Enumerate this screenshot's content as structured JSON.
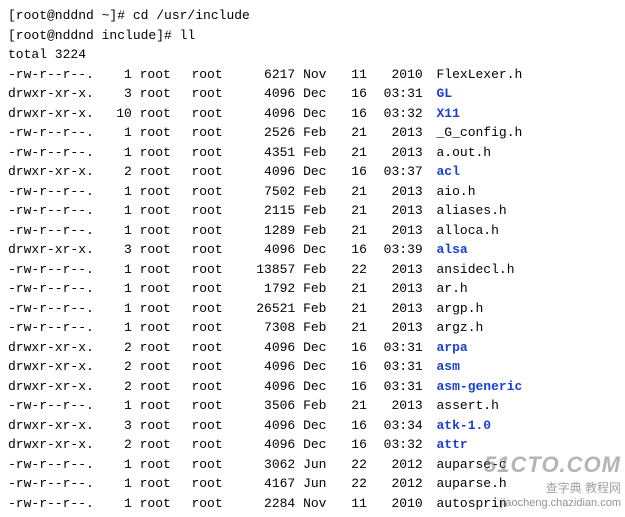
{
  "prompts": [
    {
      "prefix": "[root@nddnd ~]# ",
      "command": "cd /usr/include"
    },
    {
      "prefix": "[root@nddnd include]# ",
      "command": "ll"
    }
  ],
  "total_line": "total 3224",
  "entries": [
    {
      "perm": "-rw-r--r--.",
      "links": "1",
      "owner": "root",
      "group": "root",
      "size": "6217",
      "month": "Nov",
      "day": "11",
      "time": "2010",
      "name": "FlexLexer.h",
      "type": "file"
    },
    {
      "perm": "drwxr-xr-x.",
      "links": "3",
      "owner": "root",
      "group": "root",
      "size": "4096",
      "month": "Dec",
      "day": "16",
      "time": "03:31",
      "name": "GL",
      "type": "dir"
    },
    {
      "perm": "drwxr-xr-x.",
      "links": "10",
      "owner": "root",
      "group": "root",
      "size": "4096",
      "month": "Dec",
      "day": "16",
      "time": "03:32",
      "name": "X11",
      "type": "dir"
    },
    {
      "perm": "-rw-r--r--.",
      "links": "1",
      "owner": "root",
      "group": "root",
      "size": "2526",
      "month": "Feb",
      "day": "21",
      "time": "2013",
      "name": "_G_config.h",
      "type": "file"
    },
    {
      "perm": "-rw-r--r--.",
      "links": "1",
      "owner": "root",
      "group": "root",
      "size": "4351",
      "month": "Feb",
      "day": "21",
      "time": "2013",
      "name": "a.out.h",
      "type": "file"
    },
    {
      "perm": "drwxr-xr-x.",
      "links": "2",
      "owner": "root",
      "group": "root",
      "size": "4096",
      "month": "Dec",
      "day": "16",
      "time": "03:37",
      "name": "acl",
      "type": "dir"
    },
    {
      "perm": "-rw-r--r--.",
      "links": "1",
      "owner": "root",
      "group": "root",
      "size": "7502",
      "month": "Feb",
      "day": "21",
      "time": "2013",
      "name": "aio.h",
      "type": "file"
    },
    {
      "perm": "-rw-r--r--.",
      "links": "1",
      "owner": "root",
      "group": "root",
      "size": "2115",
      "month": "Feb",
      "day": "21",
      "time": "2013",
      "name": "aliases.h",
      "type": "file"
    },
    {
      "perm": "-rw-r--r--.",
      "links": "1",
      "owner": "root",
      "group": "root",
      "size": "1289",
      "month": "Feb",
      "day": "21",
      "time": "2013",
      "name": "alloca.h",
      "type": "file"
    },
    {
      "perm": "drwxr-xr-x.",
      "links": "3",
      "owner": "root",
      "group": "root",
      "size": "4096",
      "month": "Dec",
      "day": "16",
      "time": "03:39",
      "name": "alsa",
      "type": "dir"
    },
    {
      "perm": "-rw-r--r--.",
      "links": "1",
      "owner": "root",
      "group": "root",
      "size": "13857",
      "month": "Feb",
      "day": "22",
      "time": "2013",
      "name": "ansidecl.h",
      "type": "file"
    },
    {
      "perm": "-rw-r--r--.",
      "links": "1",
      "owner": "root",
      "group": "root",
      "size": "1792",
      "month": "Feb",
      "day": "21",
      "time": "2013",
      "name": "ar.h",
      "type": "file"
    },
    {
      "perm": "-rw-r--r--.",
      "links": "1",
      "owner": "root",
      "group": "root",
      "size": "26521",
      "month": "Feb",
      "day": "21",
      "time": "2013",
      "name": "argp.h",
      "type": "file"
    },
    {
      "perm": "-rw-r--r--.",
      "links": "1",
      "owner": "root",
      "group": "root",
      "size": "7308",
      "month": "Feb",
      "day": "21",
      "time": "2013",
      "name": "argz.h",
      "type": "file"
    },
    {
      "perm": "drwxr-xr-x.",
      "links": "2",
      "owner": "root",
      "group": "root",
      "size": "4096",
      "month": "Dec",
      "day": "16",
      "time": "03:31",
      "name": "arpa",
      "type": "dir"
    },
    {
      "perm": "drwxr-xr-x.",
      "links": "2",
      "owner": "root",
      "group": "root",
      "size": "4096",
      "month": "Dec",
      "day": "16",
      "time": "03:31",
      "name": "asm",
      "type": "dir"
    },
    {
      "perm": "drwxr-xr-x.",
      "links": "2",
      "owner": "root",
      "group": "root",
      "size": "4096",
      "month": "Dec",
      "day": "16",
      "time": "03:31",
      "name": "asm-generic",
      "type": "dir"
    },
    {
      "perm": "-rw-r--r--.",
      "links": "1",
      "owner": "root",
      "group": "root",
      "size": "3506",
      "month": "Feb",
      "day": "21",
      "time": "2013",
      "name": "assert.h",
      "type": "file"
    },
    {
      "perm": "drwxr-xr-x.",
      "links": "3",
      "owner": "root",
      "group": "root",
      "size": "4096",
      "month": "Dec",
      "day": "16",
      "time": "03:34",
      "name": "atk-1.0",
      "type": "dir"
    },
    {
      "perm": "drwxr-xr-x.",
      "links": "2",
      "owner": "root",
      "group": "root",
      "size": "4096",
      "month": "Dec",
      "day": "16",
      "time": "03:32",
      "name": "attr",
      "type": "dir"
    },
    {
      "perm": "-rw-r--r--.",
      "links": "1",
      "owner": "root",
      "group": "root",
      "size": "3062",
      "month": "Jun",
      "day": "22",
      "time": "2012",
      "name": "auparse-c",
      "type": "file"
    },
    {
      "perm": "-rw-r--r--.",
      "links": "1",
      "owner": "root",
      "group": "root",
      "size": "4167",
      "month": "Jun",
      "day": "22",
      "time": "2012",
      "name": "auparse.h",
      "type": "file"
    },
    {
      "perm": "-rw-r--r--.",
      "links": "1",
      "owner": "root",
      "group": "root",
      "size": "2284",
      "month": "Nov",
      "day": "11",
      "time": "2010",
      "name": "autosprin",
      "type": "file"
    }
  ],
  "watermark": {
    "top": "51CTO.COM",
    "cn": "查字典  教程网",
    "bot": "jiaocheng.chazidian.com"
  }
}
